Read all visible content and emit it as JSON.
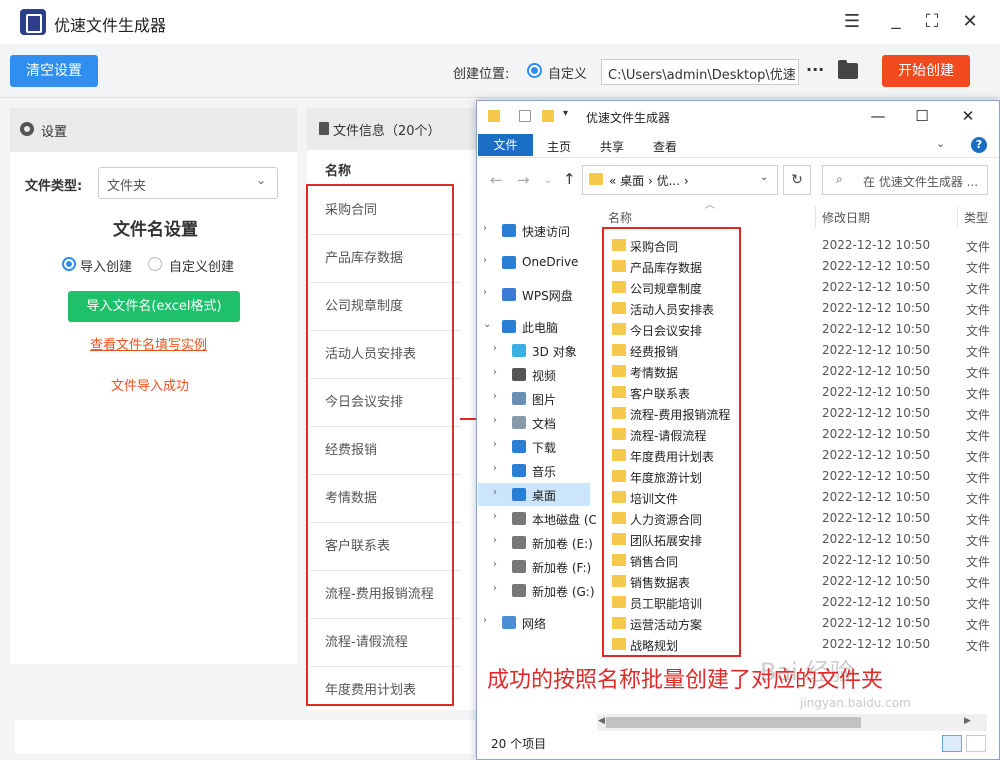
{
  "app": {
    "title": "优速文件生成器"
  },
  "toolbar": {
    "clear_label": "清空设置",
    "location_label": "创建位置:",
    "custom_label": "自定义",
    "path_value": "C:\\Users\\admin\\Desktop\\优速",
    "more_label": "···",
    "start_label": "开始创建"
  },
  "settings": {
    "title": "设置",
    "file_type_label": "文件类型:",
    "file_type_value": "文件夹",
    "filename_title": "文件名设置",
    "radio_import": "导入创建",
    "radio_custom": "自定义创建",
    "import_button": "导入文件名(excel格式)",
    "example_link": "查看文件名填写实例",
    "import_success": "文件导入成功"
  },
  "file_info": {
    "title": "文件信息（20个）",
    "name_header": "名称",
    "rows": [
      "采购合同",
      "产品库存数据",
      "公司规章制度",
      "活动人员安排表",
      "今日会议安排",
      "经费报销",
      "考情数据",
      "客户联系表",
      "流程-费用报销流程",
      "流程-请假流程",
      "年度费用计划表"
    ]
  },
  "explorer": {
    "title": "优速文件生成器",
    "tabs": [
      "文件",
      "主页",
      "共享",
      "查看"
    ],
    "address": "« 桌面 › 优... ›",
    "search_placeholder": "在 优速文件生成器 ...",
    "nav": [
      {
        "label": "快速访问",
        "icon": "star-icon"
      },
      {
        "label": "OneDrive",
        "icon": "cloud-icon"
      },
      {
        "label": "WPS网盘",
        "icon": "cloud-drive-icon"
      },
      {
        "label": "此电脑",
        "icon": "computer-icon"
      },
      {
        "label": "3D 对象",
        "icon": "cube-icon"
      },
      {
        "label": "视频",
        "icon": "video-icon"
      },
      {
        "label": "图片",
        "icon": "picture-icon"
      },
      {
        "label": "文档",
        "icon": "document-icon"
      },
      {
        "label": "下载",
        "icon": "download-icon"
      },
      {
        "label": "音乐",
        "icon": "music-icon"
      },
      {
        "label": "桌面",
        "icon": "desktop-icon"
      },
      {
        "label": "本地磁盘 (C",
        "icon": "disk-icon"
      },
      {
        "label": "新加卷 (E:)",
        "icon": "disk-icon"
      },
      {
        "label": "新加卷 (F:)",
        "icon": "disk-icon"
      },
      {
        "label": "新加卷 (G:)",
        "icon": "disk-icon"
      },
      {
        "label": "网络",
        "icon": "network-icon"
      }
    ],
    "columns": [
      "名称",
      "修改日期",
      "类型"
    ],
    "files": [
      {
        "name": "采购合同",
        "date": "2022-12-12 10:50",
        "type": "文件"
      },
      {
        "name": "产品库存数据",
        "date": "2022-12-12 10:50",
        "type": "文件"
      },
      {
        "name": "公司规章制度",
        "date": "2022-12-12 10:50",
        "type": "文件"
      },
      {
        "name": "活动人员安排表",
        "date": "2022-12-12 10:50",
        "type": "文件"
      },
      {
        "name": "今日会议安排",
        "date": "2022-12-12 10:50",
        "type": "文件"
      },
      {
        "name": "经费报销",
        "date": "2022-12-12 10:50",
        "type": "文件"
      },
      {
        "name": "考情数据",
        "date": "2022-12-12 10:50",
        "type": "文件"
      },
      {
        "name": "客户联系表",
        "date": "2022-12-12 10:50",
        "type": "文件"
      },
      {
        "name": "流程-费用报销流程",
        "date": "2022-12-12 10:50",
        "type": "文件"
      },
      {
        "name": "流程-请假流程",
        "date": "2022-12-12 10:50",
        "type": "文件"
      },
      {
        "name": "年度费用计划表",
        "date": "2022-12-12 10:50",
        "type": "文件"
      },
      {
        "name": "年度旅游计划",
        "date": "2022-12-12 10:50",
        "type": "文件"
      },
      {
        "name": "培训文件",
        "date": "2022-12-12 10:50",
        "type": "文件"
      },
      {
        "name": "人力资源合同",
        "date": "2022-12-12 10:50",
        "type": "文件"
      },
      {
        "name": "团队拓展安排",
        "date": "2022-12-12 10:50",
        "type": "文件"
      },
      {
        "name": "销售合同",
        "date": "2022-12-12 10:50",
        "type": "文件"
      },
      {
        "name": "销售数据表",
        "date": "2022-12-12 10:50",
        "type": "文件"
      },
      {
        "name": "员工职能培训",
        "date": "2022-12-12 10:50",
        "type": "文件"
      },
      {
        "name": "运营活动方案",
        "date": "2022-12-12 10:50",
        "type": "文件"
      },
      {
        "name": "战略规划",
        "date": "2022-12-12 10:50",
        "type": "文件"
      }
    ],
    "status": "20 个项目"
  },
  "annotation": {
    "caption": "成功的按照名称批量创建了对应的文件夹"
  },
  "watermark": {
    "text": "Bai 经验",
    "url": "jingyan.baidu.com"
  },
  "colors": {
    "primary": "#2f8ef0",
    "danger": "#f04a1e",
    "success": "#1fc06a",
    "annotation": "#e02a2a"
  }
}
